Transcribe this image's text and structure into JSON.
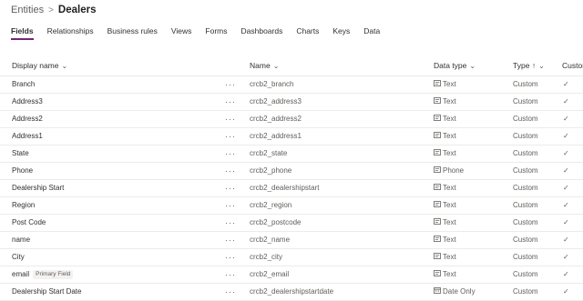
{
  "breadcrumb": {
    "root": "Entities",
    "separator": ">",
    "current": "Dealers"
  },
  "tabs": [
    "Fields",
    "Relationships",
    "Business rules",
    "Views",
    "Forms",
    "Dashboards",
    "Charts",
    "Keys",
    "Data"
  ],
  "active_tab": "Fields",
  "columns": {
    "display_name": "Display name",
    "name": "Name",
    "data_type": "Data type",
    "type": "Type",
    "type_sort": "↑",
    "custom": "Custom"
  },
  "more_label": "···",
  "rows": [
    {
      "display": "Branch",
      "badge": "",
      "name": "crcb2_branch",
      "data_type": "Text",
      "icon": "text-field-icon",
      "type": "Custom",
      "custom": "✓"
    },
    {
      "display": "Address3",
      "badge": "",
      "name": "crcb2_address3",
      "data_type": "Text",
      "icon": "text-field-icon",
      "type": "Custom",
      "custom": "✓"
    },
    {
      "display": "Address2",
      "badge": "",
      "name": "crcb2_address2",
      "data_type": "Text",
      "icon": "text-field-icon",
      "type": "Custom",
      "custom": "✓"
    },
    {
      "display": "Address1",
      "badge": "",
      "name": "crcb2_address1",
      "data_type": "Text",
      "icon": "text-field-icon",
      "type": "Custom",
      "custom": "✓"
    },
    {
      "display": "State",
      "badge": "",
      "name": "crcb2_state",
      "data_type": "Text",
      "icon": "text-field-icon",
      "type": "Custom",
      "custom": "✓"
    },
    {
      "display": "Phone",
      "badge": "",
      "name": "crcb2_phone",
      "data_type": "Phone",
      "icon": "phone-field-icon",
      "type": "Custom",
      "custom": "✓"
    },
    {
      "display": "Dealership Start",
      "badge": "",
      "name": "crcb2_dealershipstart",
      "data_type": "Text",
      "icon": "text-field-icon",
      "type": "Custom",
      "custom": "✓"
    },
    {
      "display": "Region",
      "badge": "",
      "name": "crcb2_region",
      "data_type": "Text",
      "icon": "text-field-icon",
      "type": "Custom",
      "custom": "✓"
    },
    {
      "display": "Post Code",
      "badge": "",
      "name": "crcb2_postcode",
      "data_type": "Text",
      "icon": "text-field-icon",
      "type": "Custom",
      "custom": "✓"
    },
    {
      "display": "name",
      "badge": "",
      "name": "crcb2_name",
      "data_type": "Text",
      "icon": "text-field-icon",
      "type": "Custom",
      "custom": "✓"
    },
    {
      "display": "City",
      "badge": "",
      "name": "crcb2_city",
      "data_type": "Text",
      "icon": "text-field-icon",
      "type": "Custom",
      "custom": "✓"
    },
    {
      "display": "email",
      "badge": "Primary Field",
      "name": "crcb2_email",
      "data_type": "Text",
      "icon": "text-field-icon",
      "type": "Custom",
      "custom": "✓"
    },
    {
      "display": "Dealership Start Date",
      "badge": "",
      "name": "crcb2_dealershipstartdate",
      "data_type": "Date Only",
      "icon": "calendar-icon",
      "type": "Custom",
      "custom": "✓"
    }
  ],
  "colors": {
    "accent": "#742774",
    "text": "#323130",
    "muted": "#605e5c",
    "divider": "#edebe9"
  }
}
